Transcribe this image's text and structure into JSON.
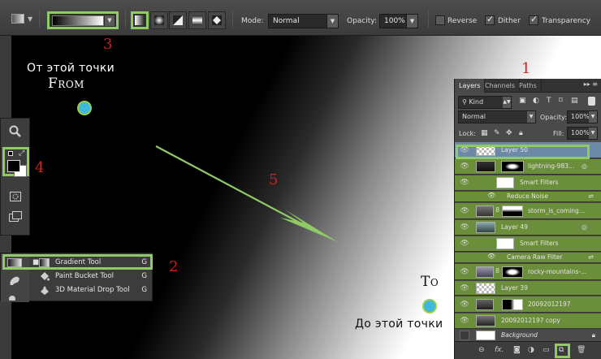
{
  "options_bar": {
    "mode_label": "Mode:",
    "mode_value": "Normal",
    "opacity_label": "Opacity:",
    "opacity_value": "100%",
    "reverse_label": "Reverse",
    "dither_label": "Dither",
    "transparency_label": "Transparency",
    "reverse_checked": false,
    "dither_checked": true,
    "transparency_checked": true,
    "gradient_types": [
      "linear-gradient-icon",
      "radial-gradient-icon",
      "angle-gradient-icon",
      "reflected-gradient-icon",
      "diamond-gradient-icon"
    ]
  },
  "annotations": {
    "from_ru": "От этой точки",
    "from_en": "From",
    "to_en": "To",
    "to_ru": "До этой точки",
    "n1": "1",
    "n2": "2",
    "n3": "3",
    "n4": "4",
    "n5": "5",
    "highlight_color": "#8ecb66",
    "number_color": "#d21f1f",
    "dot_color": "#3fb8d9"
  },
  "tool_flyout": {
    "items": [
      {
        "label": "Gradient Tool",
        "key": "G",
        "selected": true
      },
      {
        "label": "Paint Bucket Tool",
        "key": "G",
        "selected": false
      },
      {
        "label": "3D Material Drop Tool",
        "key": "G",
        "selected": false
      }
    ]
  },
  "layers_panel": {
    "tabs": [
      "Layers",
      "Channels",
      "Paths"
    ],
    "filter_kind": "Kind",
    "blend_mode": "Normal",
    "opacity_label": "Opacity:",
    "opacity_value": "100%",
    "lock_label": "Lock:",
    "fill_label": "Fill:",
    "fill_value": "100%",
    "layers": [
      {
        "name": "Layer 50",
        "selected": true
      },
      {
        "name": "lightning-983..."
      },
      {
        "name": "Smart Filters"
      },
      {
        "name": "Reduce Noise"
      },
      {
        "name": "storm_is_coming..."
      },
      {
        "name": "Layer 49"
      },
      {
        "name": "Smart Filters"
      },
      {
        "name": "Camera Raw Filter"
      },
      {
        "name": "rocky-mountains-..."
      },
      {
        "name": "Layer 39"
      },
      {
        "name": "20092012197"
      },
      {
        "name": "20092012197 copy"
      },
      {
        "name": "Background"
      }
    ]
  }
}
